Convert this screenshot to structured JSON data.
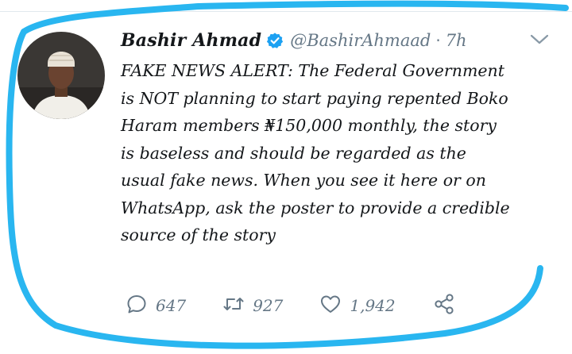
{
  "tweet": {
    "author_name": "Bashir Ahmad",
    "handle": "@BashirAhmaad",
    "separator": "·",
    "time": "7h",
    "text": "FAKE NEWS ALERT: The Federal Government\nis NOT planning to start paying repented Boko\nHaram members ₦150,000 monthly, the story\nis baseless and should be regarded as the\nusual fake news. When you see it here or on\nWhatsApp, ask the poster to provide a credible\nsource of the story",
    "verified": true
  },
  "actions": {
    "replies": "647",
    "retweets": "927",
    "likes": "1,942"
  },
  "icons": {
    "verified": "verified-badge-icon",
    "chevron": "chevron-down-icon",
    "reply": "reply-icon",
    "retweet": "retweet-icon",
    "like": "heart-icon",
    "share": "share-icon"
  },
  "colors": {
    "accent": "#1da1f2",
    "highlight_stroke": "#29b6f0",
    "muted": "#657786",
    "text": "#14171a"
  }
}
